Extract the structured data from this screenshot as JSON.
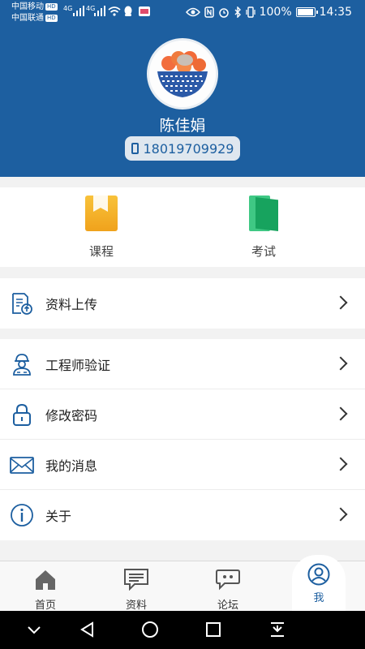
{
  "status_bar": {
    "carrier1": "中国移动",
    "carrier2": "中国联通",
    "hd_badge": "HD",
    "net1": "4G",
    "net2": "4G",
    "battery_text": "100%",
    "battery_level": 1.0,
    "time": "14:35"
  },
  "profile": {
    "name": "陈佳娟",
    "phone": "18019709929"
  },
  "quick_actions": [
    {
      "label": "课程",
      "icon": "course-book-icon"
    },
    {
      "label": "考试",
      "icon": "exam-book-icon"
    }
  ],
  "menu": {
    "upload": {
      "label": "资料上传",
      "icon": "document-upload-icon"
    },
    "engineer": {
      "label": "工程师验证",
      "icon": "engineer-icon"
    },
    "password": {
      "label": "修改密码",
      "icon": "lock-icon"
    },
    "messages": {
      "label": "我的消息",
      "icon": "mail-icon"
    },
    "about": {
      "label": "关于",
      "icon": "info-icon"
    }
  },
  "tabs": [
    {
      "label": "首页",
      "icon": "home-icon"
    },
    {
      "label": "资料",
      "icon": "document-icon"
    },
    {
      "label": "论坛",
      "icon": "chat-icon"
    },
    {
      "label": "我",
      "icon": "user-icon",
      "active": true
    }
  ],
  "colors": {
    "primary": "#1d5fa0",
    "background": "#f2f2f2"
  }
}
